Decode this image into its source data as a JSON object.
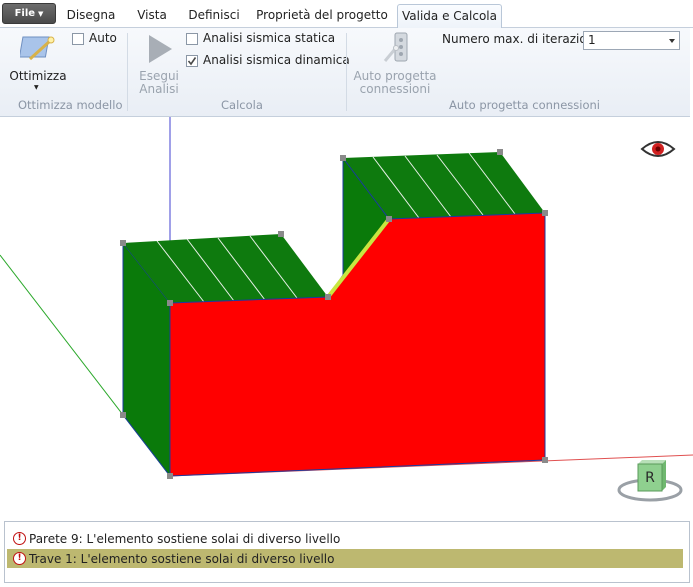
{
  "tabs": {
    "file": "File",
    "items": [
      "Disegna",
      "Vista",
      "Definisci",
      "Proprietà del progetto",
      "Valida e Calcola"
    ],
    "active": 4
  },
  "ribbon": {
    "ottimizza": {
      "button": "Ottimizza",
      "auto_label": "Auto",
      "auto_checked": false,
      "group_label": "Ottimizza modello"
    },
    "calcola": {
      "button_line1": "Esegui",
      "button_line2": "Analisi",
      "static_label": "Analisi sismica statica",
      "static_checked": false,
      "dynamic_label": "Analisi sismica dinamica",
      "dynamic_checked": true,
      "group_label": "Calcola"
    },
    "connessioni": {
      "button_line1": "Auto progetta",
      "button_line2": "connessioni",
      "iter_label": "Numero max. di iterazioni",
      "iter_value": "1",
      "group_label": "Auto progetta connessioni"
    }
  },
  "viewport": {
    "cube_label": "R",
    "colors": {
      "wall_front": "#ff0000",
      "wall_side": "#0a7a0a",
      "slab": "#0e7a0e",
      "highlight_beam": "#c8e640"
    }
  },
  "messages": [
    {
      "text": "Parete 9: L'elemento sostiene solai di diverso livello",
      "selected": false
    },
    {
      "text": "Trave 1: L'elemento sostiene solai di diverso livello",
      "selected": true
    }
  ]
}
